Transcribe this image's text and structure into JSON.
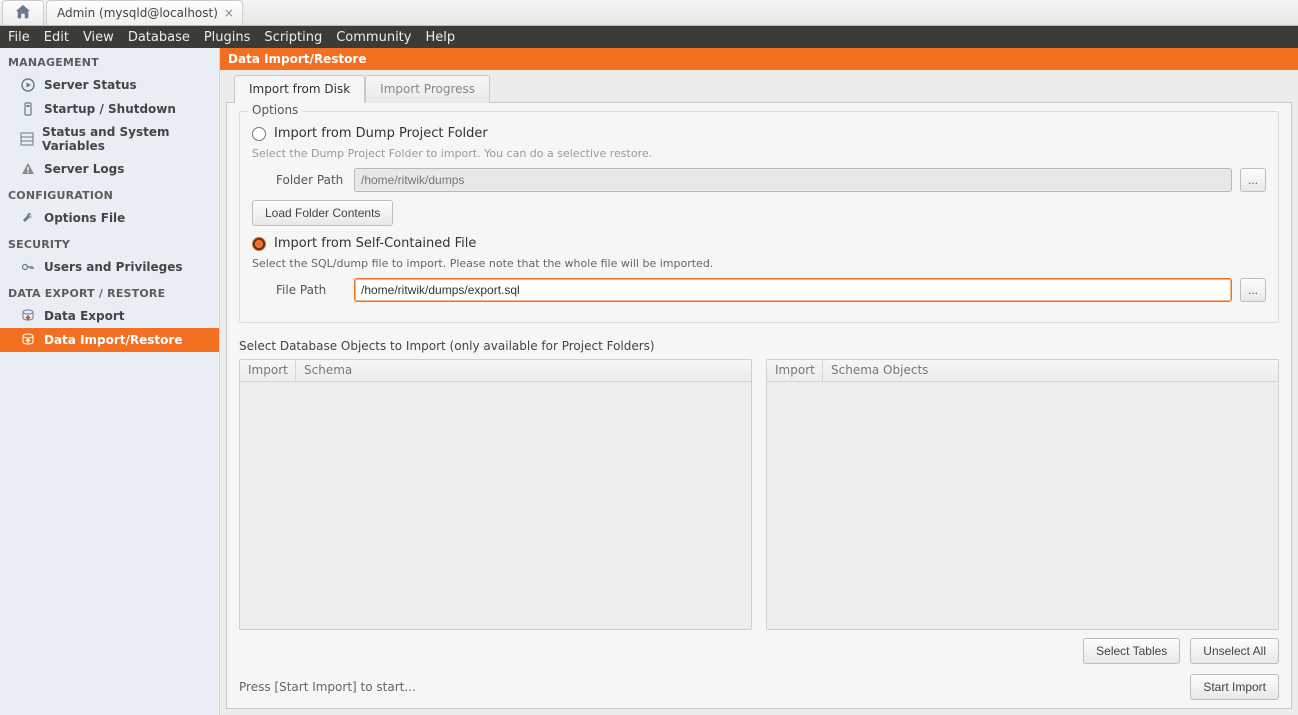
{
  "window": {
    "tab_label": "Admin (mysqld@localhost)"
  },
  "menubar": [
    "File",
    "Edit",
    "View",
    "Database",
    "Plugins",
    "Scripting",
    "Community",
    "Help"
  ],
  "sidebar": {
    "sections": [
      {
        "title": "MANAGEMENT",
        "items": [
          {
            "label": "Server Status",
            "icon": "play-circle"
          },
          {
            "label": "Startup / Shutdown",
            "icon": "server"
          },
          {
            "label": "Status and System Variables",
            "icon": "grid"
          },
          {
            "label": "Server Logs",
            "icon": "warning"
          }
        ]
      },
      {
        "title": "CONFIGURATION",
        "items": [
          {
            "label": "Options File",
            "icon": "wrench"
          }
        ]
      },
      {
        "title": "SECURITY",
        "items": [
          {
            "label": "Users and Privileges",
            "icon": "key"
          }
        ]
      },
      {
        "title": "DATA EXPORT / RESTORE",
        "items": [
          {
            "label": "Data Export",
            "icon": "db-out"
          },
          {
            "label": "Data Import/Restore",
            "icon": "db-in",
            "active": true
          }
        ]
      }
    ]
  },
  "page": {
    "title": "Data Import/Restore",
    "tabs": [
      {
        "label": "Import from Disk",
        "active": true
      },
      {
        "label": "Import Progress",
        "active": false
      }
    ]
  },
  "options": {
    "legend": "Options",
    "dump_radio_label": "Import from Dump Project Folder",
    "dump_help": "Select the Dump Project Folder to import. You can do a selective restore.",
    "folder_path_label": "Folder Path",
    "folder_path_placeholder": "/home/ritwik/dumps",
    "load_folder_btn": "Load Folder Contents",
    "self_radio_label": "Import from Self-Contained File",
    "self_help": "Select the SQL/dump file to import. Please note that the whole file will be imported.",
    "file_path_label": "File Path",
    "file_path_value": "/home/ritwik/dumps/export.sql",
    "browse_label": "..."
  },
  "objects": {
    "section_label": "Select Database Objects to Import (only available for Project Folders)",
    "left_headers": [
      "Import",
      "Schema"
    ],
    "right_headers": [
      "Import",
      "Schema Objects"
    ],
    "select_tables_btn": "Select Tables",
    "unselect_all_btn": "Unselect All"
  },
  "footer": {
    "status": "Press [Start Import] to start...",
    "start_btn": "Start Import"
  }
}
